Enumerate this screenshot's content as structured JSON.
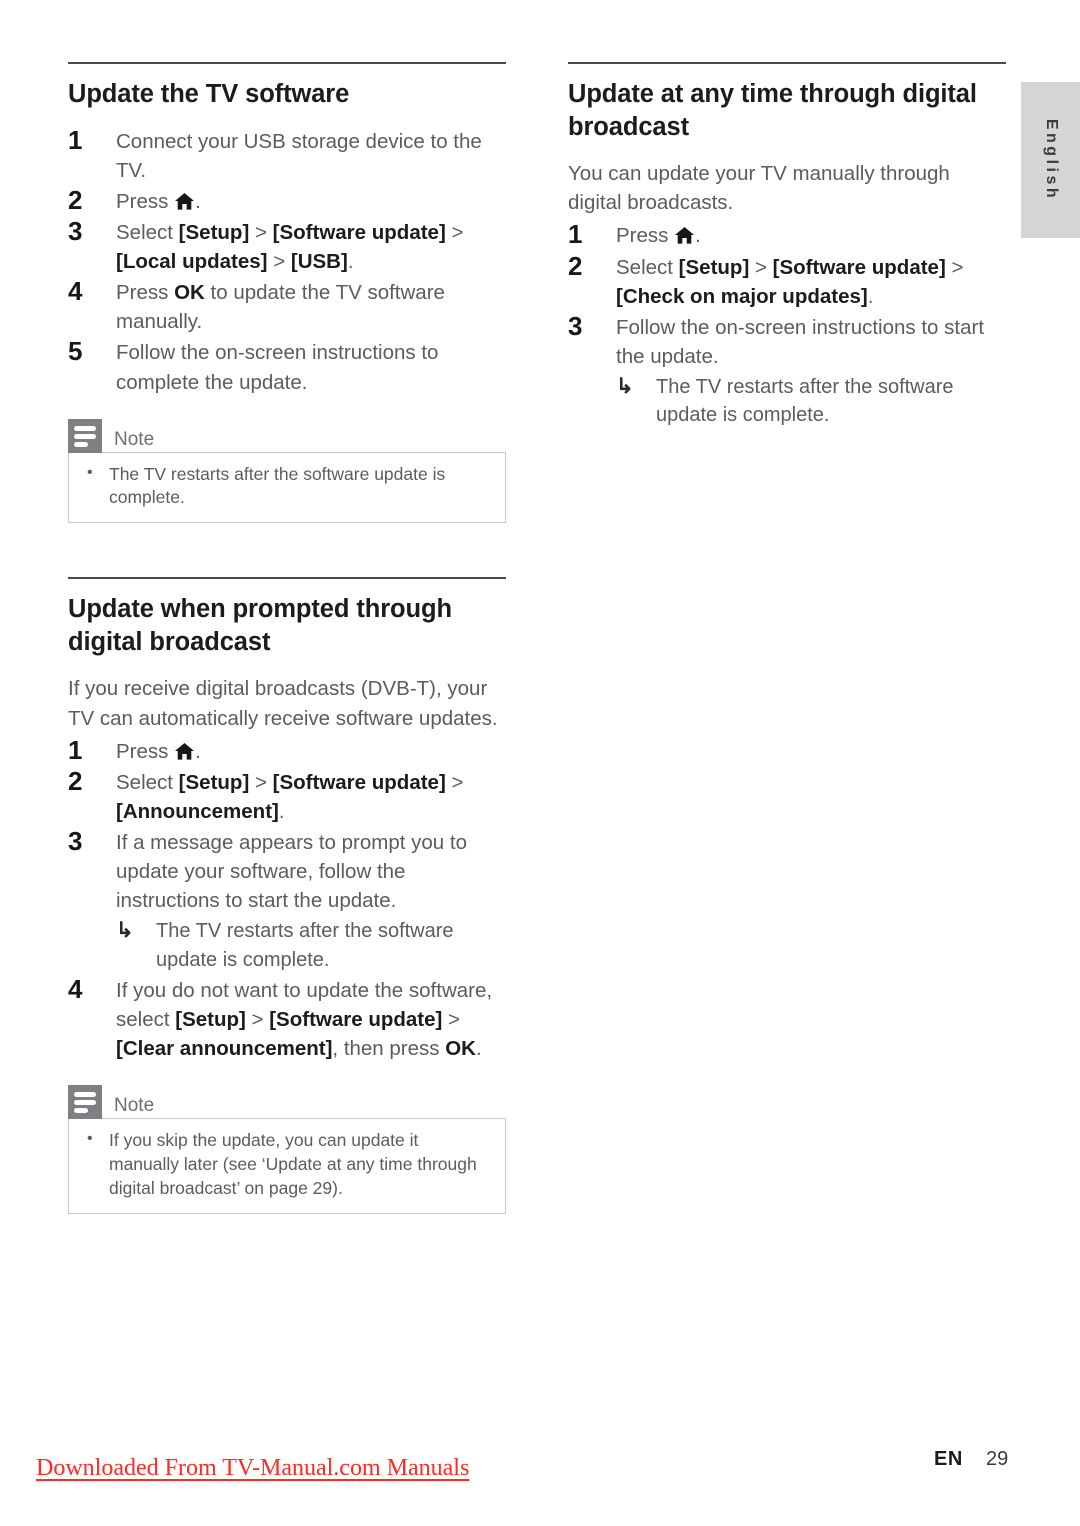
{
  "page": {
    "language_tab": "English",
    "footer": {
      "watermark_link": "Downloaded From TV-Manual.com Manuals",
      "locale_code": "EN",
      "page_number": "29"
    }
  },
  "left_column": {
    "section1": {
      "heading": "Update the TV software",
      "steps": [
        {
          "num": "1",
          "text": "Connect your USB storage device to the TV."
        },
        {
          "num": "2",
          "text_before": "Press ",
          "icon": "home-icon",
          "text_after": "."
        },
        {
          "num": "3",
          "text_before": "Select ",
          "b1": "[Setup]",
          "sep1": " > ",
          "b2": "[Software update]",
          "sep2": " > ",
          "b3": "[Local updates]",
          "sep3": " > ",
          "b4": "[USB]",
          "text_after": "."
        },
        {
          "num": "4",
          "text_before": "Press ",
          "b1": "OK",
          "text_after": " to update the TV software manually."
        },
        {
          "num": "5",
          "text": "Follow the on-screen instructions to complete the update."
        }
      ],
      "note": {
        "title": "Note",
        "items": [
          "The TV restarts after the software update is complete."
        ]
      }
    },
    "section2": {
      "heading": "Update when prompted through digital broadcast",
      "intro": "If you receive digital broadcasts (DVB-T), your TV can automatically receive software updates.",
      "steps": [
        {
          "num": "1",
          "text_before": "Press ",
          "icon": "home-icon",
          "text_after": "."
        },
        {
          "num": "2",
          "text_before": "Select ",
          "b1": "[Setup]",
          "sep1": " > ",
          "b2": "[Software update]",
          "sep2": " > ",
          "b3": "[Announcement]",
          "text_after": "."
        },
        {
          "num": "3",
          "text": "If a message appears to prompt you to update your software, follow the instructions to start the update.",
          "subline": "The TV restarts after the software update is complete."
        },
        {
          "num": "4",
          "text_before": "If you do not want to update the software, select ",
          "b1": "[Setup]",
          "sep1": " > ",
          "b2": "[Software update]",
          "sep2": " > ",
          "b3": "[Clear announcement]",
          "mid": ", then press ",
          "b4": "OK",
          "text_after": "."
        }
      ],
      "note": {
        "title": "Note",
        "items": [
          "If you skip the update, you can update it manually later (see ‘Update at any time through digital broadcast’ on page 29)."
        ]
      }
    }
  },
  "right_column": {
    "section1": {
      "heading": "Update at any time through digital broadcast",
      "intro": "You can update your TV manually through digital broadcasts.",
      "steps": [
        {
          "num": "1",
          "text_before": "Press ",
          "icon": "home-icon",
          "text_after": "."
        },
        {
          "num": "2",
          "text_before": "Select ",
          "b1": "[Setup]",
          "sep1": " > ",
          "b2": "[Software update]",
          "sep2": " > ",
          "b3": "[Check on major updates]",
          "text_after": "."
        },
        {
          "num": "3",
          "text": "Follow the on-screen instructions to start the update.",
          "subline": "The TV restarts after the software update is complete."
        }
      ]
    }
  },
  "icons": {
    "hook_arrow": "↳",
    "bullet": "•"
  },
  "colors": {
    "heading": "#1c1c1e",
    "body": "#5c5c60",
    "rule": "#4a4a4e",
    "note_icon_bg": "#7f7f84",
    "note_border": "#c9c9cc",
    "lang_tab_bg": "#d4d5d7",
    "watermark": "#ff2a20"
  }
}
